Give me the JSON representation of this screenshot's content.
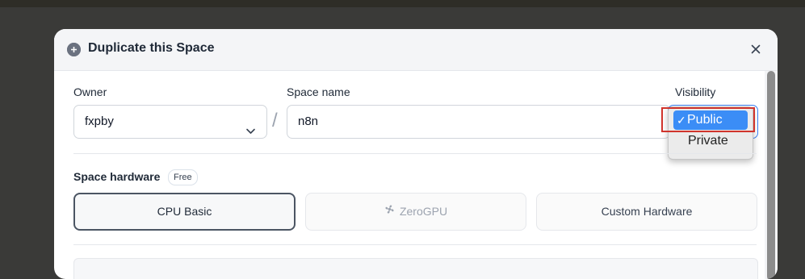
{
  "dialog": {
    "title": "Duplicate this Space",
    "icon": "duplicate-icon",
    "close_icon": "close-icon"
  },
  "form": {
    "owner_label": "Owner",
    "owner_value": "fxpby",
    "separator": "/",
    "space_name_label": "Space name",
    "space_name_value": "n8n",
    "visibility_label": "Visibility",
    "visibility_options": [
      "Public",
      "Private"
    ],
    "visibility_selected": "Public",
    "check_mark": "✓"
  },
  "hardware": {
    "title": "Space hardware",
    "badge": "Free",
    "options": [
      {
        "label": "CPU Basic",
        "state": "selected"
      },
      {
        "label": "ZeroGPU",
        "state": "disabled",
        "icon": "fan-icon"
      },
      {
        "label": "Custom Hardware",
        "state": "default"
      }
    ]
  },
  "colors": {
    "accent": "#3b8df6",
    "highlight": "#d0342c"
  }
}
